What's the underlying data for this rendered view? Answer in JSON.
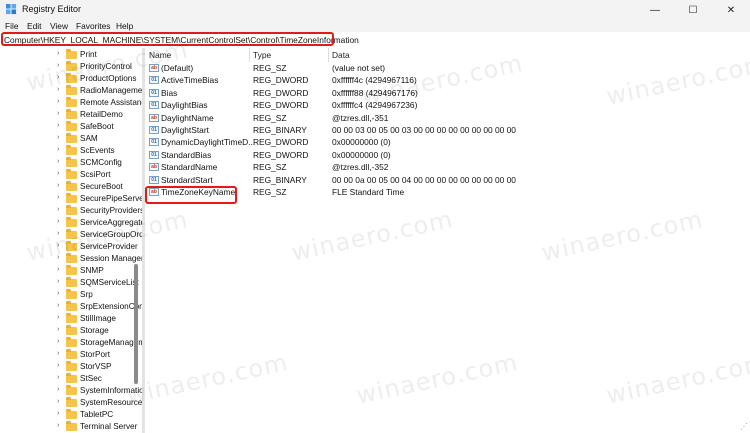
{
  "window": {
    "title": "Registry Editor",
    "minimize_glyph": "—",
    "maximize_glyph": "☐",
    "close_glyph": "✕",
    "app_icon": "registry-editor-icon"
  },
  "menu": [
    "File",
    "Edit",
    "View",
    "Favorites",
    "Help"
  ],
  "address": "Computer\\HKEY_LOCAL_MACHINE\\SYSTEM\\CurrentControlSet\\Control\\TimeZoneInformation",
  "tree": {
    "items": [
      {
        "label": "Print"
      },
      {
        "label": "PriorityControl"
      },
      {
        "label": "ProductOptions"
      },
      {
        "label": "RadioManagement"
      },
      {
        "label": "Remote Assistance"
      },
      {
        "label": "RetailDemo"
      },
      {
        "label": "SafeBoot"
      },
      {
        "label": "SAM"
      },
      {
        "label": "ScEvents"
      },
      {
        "label": "SCMConfig"
      },
      {
        "label": "ScsiPort"
      },
      {
        "label": "SecureBoot"
      },
      {
        "label": "SecurePipeServers"
      },
      {
        "label": "SecurityProviders"
      },
      {
        "label": "ServiceAggregatedEvents"
      },
      {
        "label": "ServiceGroupOrder"
      },
      {
        "label": "ServiceProvider"
      },
      {
        "label": "Session Manager"
      },
      {
        "label": "SNMP"
      },
      {
        "label": "SQMServiceList"
      },
      {
        "label": "Srp"
      },
      {
        "label": "SrpExtensionConfig"
      },
      {
        "label": "StillImage"
      },
      {
        "label": "Storage"
      },
      {
        "label": "StorageManagement"
      },
      {
        "label": "StorPort"
      },
      {
        "label": "StorVSP"
      },
      {
        "label": "StSec"
      },
      {
        "label": "SystemInformation"
      },
      {
        "label": "SystemResources"
      },
      {
        "label": "TabletPC"
      },
      {
        "label": "Terminal Server"
      }
    ]
  },
  "columns": {
    "name": "Name",
    "type": "Type",
    "data": "Data"
  },
  "values": [
    {
      "name": "(Default)",
      "type": "REG_SZ",
      "data": "(value not set)",
      "icon": "ab"
    },
    {
      "name": "ActiveTimeBias",
      "type": "REG_DWORD",
      "data": "0xffffff4c (4294967116)",
      "icon": "bin"
    },
    {
      "name": "Bias",
      "type": "REG_DWORD",
      "data": "0xffffff88 (4294967176)",
      "icon": "bin"
    },
    {
      "name": "DaylightBias",
      "type": "REG_DWORD",
      "data": "0xffffffc4 (4294967236)",
      "icon": "bin"
    },
    {
      "name": "DaylightName",
      "type": "REG_SZ",
      "data": "@tzres.dll,-351",
      "icon": "ab"
    },
    {
      "name": "DaylightStart",
      "type": "REG_BINARY",
      "data": "00 00 03 00 05 00 03 00 00 00 00 00 00 00 00 00",
      "icon": "bin"
    },
    {
      "name": "DynamicDaylightTimeD...",
      "type": "REG_DWORD",
      "data": "0x00000000 (0)",
      "icon": "bin"
    },
    {
      "name": "StandardBias",
      "type": "REG_DWORD",
      "data": "0x00000000 (0)",
      "icon": "bin"
    },
    {
      "name": "StandardName",
      "type": "REG_SZ",
      "data": "@tzres.dll,-352",
      "icon": "ab"
    },
    {
      "name": "StandardStart",
      "type": "REG_BINARY",
      "data": "00 00 0a 00 05 00 04 00 00 00 00 00 00 00 00 00",
      "icon": "bin"
    },
    {
      "name": "TimeZoneKeyName",
      "type": "REG_SZ",
      "data": "FLE Standard Time",
      "icon": "ab"
    }
  ],
  "watermark": "winaero.com",
  "accent_highlight": "#e01b1b"
}
